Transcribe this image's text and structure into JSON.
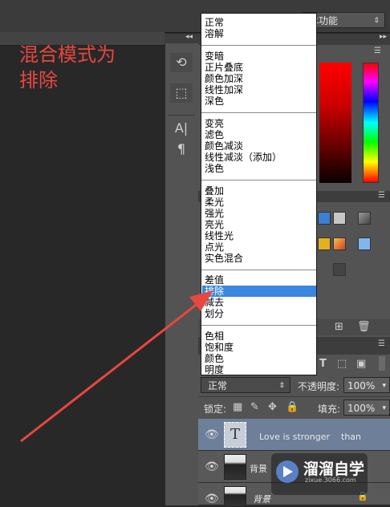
{
  "annotation": {
    "line1": "混合模式为",
    "line2": "排除"
  },
  "workspace": {
    "label": "本功能"
  },
  "blend_menu": {
    "items": [
      "正常",
      "溶解",
      "变暗",
      "正片叠底",
      "颜色加深",
      "线性加深",
      "深色",
      "变亮",
      "滤色",
      "颜色减淡",
      "线性减淡（添加）",
      "浅色",
      "叠加",
      "柔光",
      "强光",
      "亮光",
      "线性光",
      "点光",
      "实色混合",
      "差值",
      "排除",
      "减去",
      "划分",
      "色相",
      "饱和度",
      "颜色",
      "明度"
    ],
    "selected": "排除"
  },
  "layers_panel": {
    "blend_mode_value": "正常",
    "opacity_label": "不透明度:",
    "opacity_value": "100%",
    "lock_label": "锁定:",
    "fill_label": "填充:",
    "fill_value": "100%",
    "layers": [
      {
        "name": "Love is stronger    than",
        "type": "text",
        "selected": true
      },
      {
        "name": "背景",
        "type": "image",
        "selected": false
      },
      {
        "name": "背景",
        "type": "image",
        "selected": false
      }
    ]
  },
  "watermark": {
    "title": "溜溜自学",
    "sub": "zixue.3066.com"
  },
  "colors": {
    "accent": "#3b86e0",
    "annotation": "#e8473f",
    "layer_selected": "#6d7f99"
  }
}
